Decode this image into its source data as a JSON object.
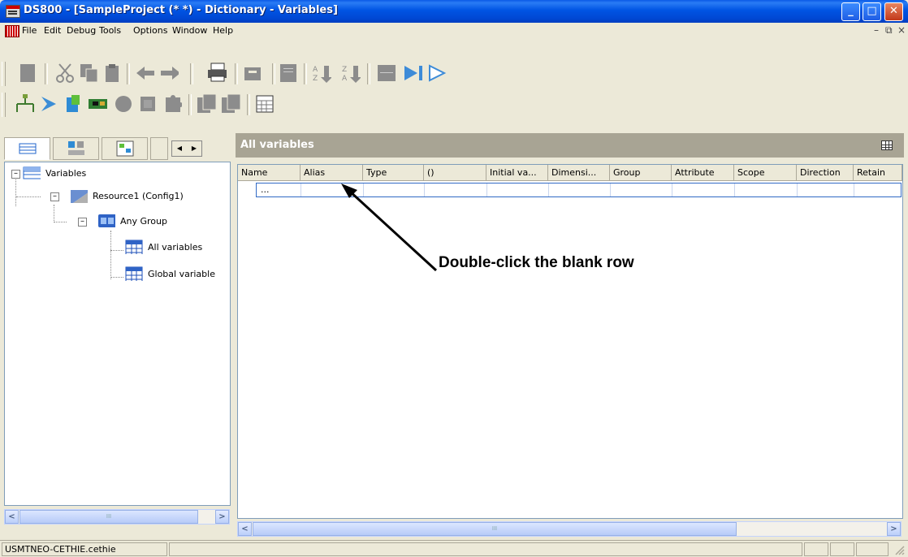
{
  "window": {
    "title": "DS800 - [SampleProject (*  *) - Dictionary - Variables]",
    "controls": {
      "minimize": "_",
      "maximize": "□",
      "close": "✕"
    }
  },
  "menubar": {
    "items": [
      "File",
      "Edit",
      "Debug",
      "Tools",
      "Options",
      "Window",
      "Help"
    ],
    "mdi_controls": {
      "minimize": "–",
      "restore": "⧉",
      "close": "×"
    }
  },
  "toolbar1": {
    "icons": [
      "new-icon",
      "cut-icon",
      "copy-icon",
      "paste-icon",
      "undo-icon",
      "redo-icon",
      "print-icon",
      "find-icon",
      "properties-icon",
      "sort-ascending-icon",
      "sort-descending-icon",
      "grid-icon",
      "step-icon",
      "run-icon"
    ]
  },
  "toolbar2": {
    "icons": [
      "network-icon",
      "connect-icon",
      "resource-icon",
      "board-icon",
      "circle-icon",
      "square-icon",
      "puzzle-icon",
      "import-icon",
      "export-icon",
      "spreadsheet-icon"
    ]
  },
  "left_pane": {
    "tabs": [
      "dictionary-tab",
      "hardware-tab",
      "link-tab"
    ],
    "tab_scroll": {
      "left": "◀",
      "right": "▶"
    },
    "tree": [
      {
        "label": "Variables",
        "expand": "–"
      },
      {
        "label": "Resource1 (Config1)",
        "expand": "–"
      },
      {
        "label": "Any Group",
        "expand": "–"
      },
      {
        "label": "All variables"
      },
      {
        "label": "Global variable"
      }
    ],
    "scroll": {
      "left": "<",
      "right": ">",
      "grip": "III"
    }
  },
  "right_pane": {
    "header_title": "All variables",
    "columns": [
      "Name",
      "Alias",
      "Type",
      "()",
      "Initial va...",
      "Dimensi...",
      "Group",
      "Attribute",
      "Scope",
      "Direction",
      "Retain"
    ],
    "blank_row": "...",
    "scroll": {
      "left": "<",
      "right": ">",
      "grip": "III"
    }
  },
  "annotation": {
    "text": "Double-click the blank row"
  },
  "statusbar": {
    "user": "USMTNEO-CETHIE.cethie"
  }
}
